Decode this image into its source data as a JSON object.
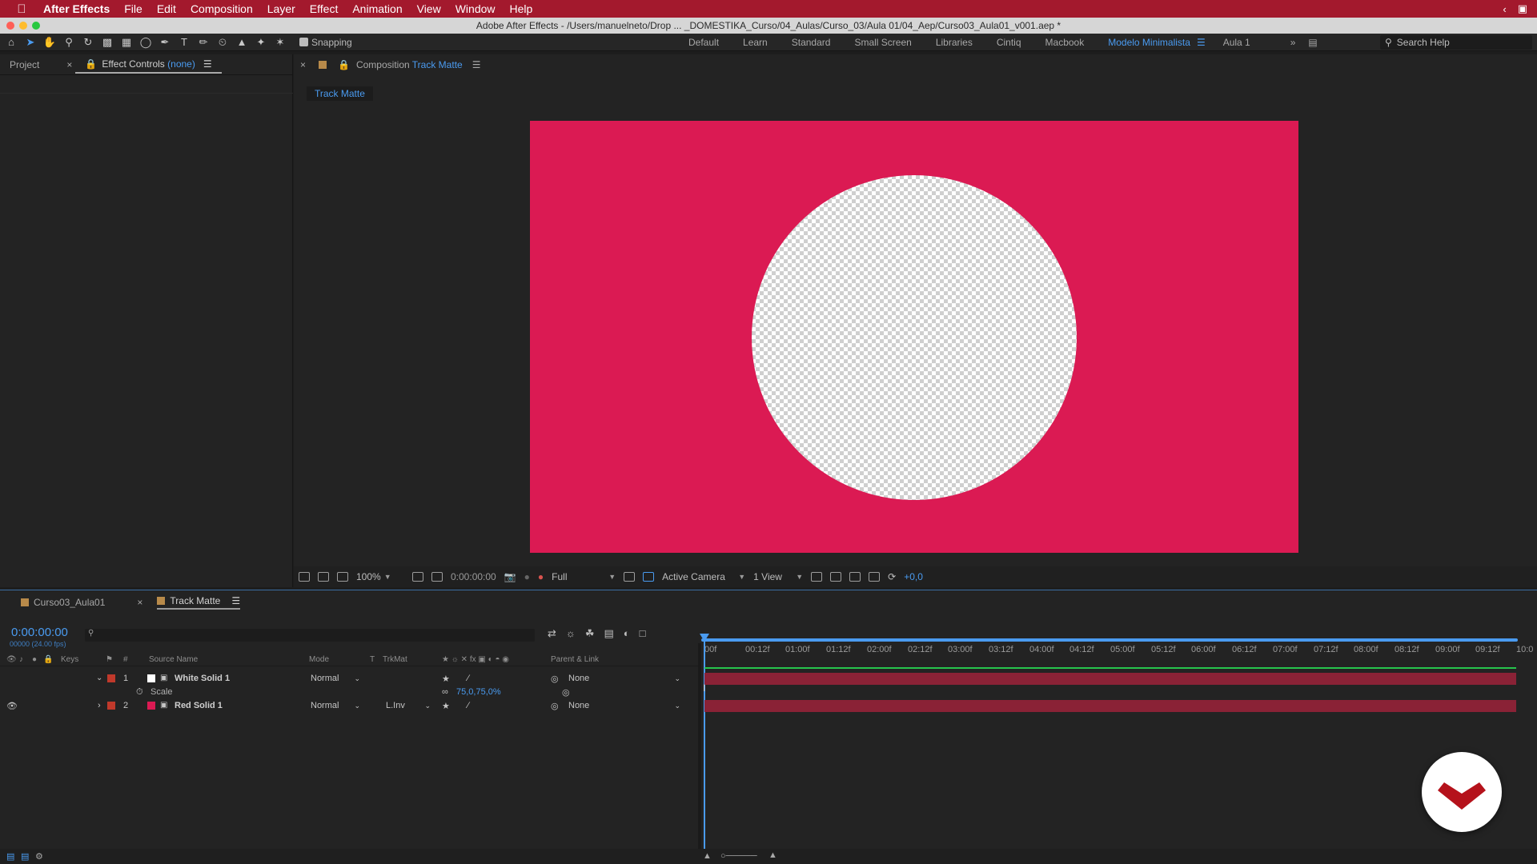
{
  "menubar": {
    "app_name": "After Effects",
    "items": [
      "File",
      "Edit",
      "Composition",
      "Layer",
      "Effect",
      "Animation",
      "View",
      "Window",
      "Help"
    ]
  },
  "window": {
    "title": "Adobe After Effects - /Users/manuelneto/Drop ... _DOMESTIKA_Curso/04_Aulas/Curso_03/Aula 01/04_Aep/Curso03_Aula01_v001.aep *"
  },
  "toolbar": {
    "snapping_label": "Snapping",
    "workspaces": [
      "Default",
      "Learn",
      "Standard",
      "Small Screen",
      "Libraries",
      "Cintiq",
      "Macbook",
      "Modelo Minimalista",
      "Aula 1"
    ],
    "active_workspace": "Modelo Minimalista",
    "search_placeholder": "Search Help"
  },
  "left_panel": {
    "tab_project": "Project",
    "tab_effect_controls": "Effect Controls",
    "effect_controls_target": "(none)"
  },
  "composition_panel": {
    "tab_prefix": "Composition",
    "comp_name": "Track Matte",
    "subtab": "Track Matte",
    "canvas_color": "#db1a53",
    "viewer": {
      "zoom": "100%",
      "timecode": "0:00:00:00",
      "resolution": "Full",
      "camera": "Active Camera",
      "views": "1 View",
      "exposure": "+0,0"
    }
  },
  "timeline": {
    "tabs": [
      {
        "label": "Curso03_Aula01",
        "color": "#b88a4a"
      },
      {
        "label": "Track Matte",
        "color": "#b88a4a"
      }
    ],
    "timecode": "0:00:00:00",
    "frames": "00000 (24.00 fps)",
    "columns": {
      "keys": "Keys",
      "num": "#",
      "source_name": "Source Name",
      "mode": "Mode",
      "t": "T",
      "trkmat": "TrkMat",
      "parent": "Parent & Link"
    },
    "layers": [
      {
        "num": "1",
        "name": "White Solid 1",
        "mode": "Normal",
        "trkmat": "",
        "parent": "None",
        "color": "#ffffff",
        "label_color": "#c0392b"
      },
      {
        "num": "2",
        "name": "Red Solid 1",
        "mode": "Normal",
        "trkmat": "L.Inv",
        "parent": "None",
        "color": "#db1a53",
        "label_color": "#c0392b"
      }
    ],
    "property": {
      "name": "Scale",
      "value": "75,0,75,0%"
    },
    "ruler_labels": [
      "00f",
      "00:12f",
      "01:00f",
      "01:12f",
      "02:00f",
      "02:12f",
      "03:00f",
      "03:12f",
      "04:00f",
      "04:12f",
      "05:00f",
      "05:12f",
      "06:00f",
      "06:12f",
      "07:00f",
      "07:12f",
      "08:00f",
      "08:12f",
      "09:00f",
      "09:12f",
      "10:0"
    ],
    "track_color": "#8a2236"
  }
}
